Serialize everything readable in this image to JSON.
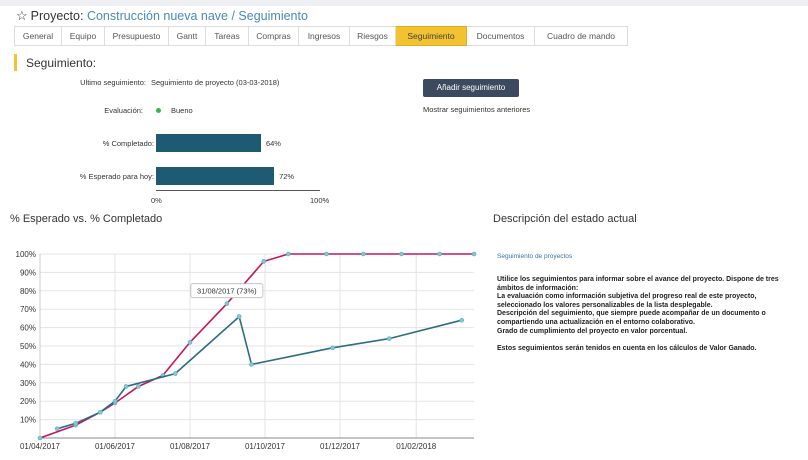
{
  "header": {
    "star_icon": "star-outline-icon",
    "prefix": "Proyecto:",
    "project_path": "Construcción nueva nave / Seguimiento"
  },
  "tabs": [
    {
      "label": "General",
      "active": false
    },
    {
      "label": "Equipo",
      "active": false
    },
    {
      "label": "Presupuesto",
      "active": false
    },
    {
      "label": "Gantt",
      "active": false
    },
    {
      "label": "Tareas",
      "active": false
    },
    {
      "label": "Compras",
      "active": false
    },
    {
      "label": "Ingresos",
      "active": false
    },
    {
      "label": "Riesgos",
      "active": false
    },
    {
      "label": "Seguimiento",
      "active": true
    },
    {
      "label": "Documentos",
      "active": false
    },
    {
      "label": "Cuadro de mando",
      "active": false
    }
  ],
  "seguimiento": {
    "section_title": "Seguimiento:",
    "last_label": "Ultimo seguimiento:",
    "last_value": "Seguimiento de proyecto (03-03-2018)",
    "eval_label": "Evaluación:",
    "eval_value": "Bueno",
    "eval_color": "#3cb44b",
    "add_button": "Añadir seguimiento",
    "show_prev": "Mostrar seguimientos anteriores"
  },
  "progress": {
    "completed_label": "% Completado:",
    "completed_value": "64%",
    "completed_fraction": 0.64,
    "expected_label": "% Esperado para hoy:",
    "expected_value": "72%",
    "expected_fraction": 0.72,
    "axis_min": "0%",
    "axis_max": "100%",
    "bar_color": "#1f5a73"
  },
  "chart_section_title": "% Esperado vs. % Completado",
  "description": {
    "title": "Descripción del estado actual",
    "subtitle": "Seguimiento de proyectos",
    "lines": [
      "Utilice los seguimientos para informar sobre el avance del proyecto. Dispone de tres",
      "ámbitos de información:",
      "La evaluación como información subjetiva del progreso real de este proyecto,",
      "seleccionado los valores personalizables de la lista desplegable.",
      "Descripción del seguimiento, que siempre puede acompañar de un documento o",
      "compartiendo una actualización en el entorno colaborativo.",
      "Grado de cumplimiento del proyecto en valor porcentual."
    ],
    "closing": "Estos seguimientos serán tenidos en cuenta en los cálculos de Valor Ganado."
  },
  "chart_data": {
    "type": "line",
    "title": "% Esperado vs. % Completado",
    "xlabel": "",
    "ylabel": "",
    "x_tick_labels": [
      "01/04/2017",
      "01/06/2017",
      "01/08/2017",
      "01/10/2017",
      "01/12/2017",
      "01/02/2018"
    ],
    "y_tick_labels": [
      "10%",
      "20%",
      "30%",
      "40%",
      "50%",
      "60%",
      "70%",
      "80%",
      "90%",
      "100%"
    ],
    "ylim": [
      0,
      100
    ],
    "xlim": [
      "2017-04-01",
      "2018-03-20"
    ],
    "grid": true,
    "series": [
      {
        "color": "#c2185b",
        "points": [
          {
            "x": "2017-04-01",
            "y": 0
          },
          {
            "x": "2017-04-30",
            "y": 7
          },
          {
            "x": "2017-05-20",
            "y": 14
          },
          {
            "x": "2017-06-01",
            "y": 19
          },
          {
            "x": "2017-06-20",
            "y": 28
          },
          {
            "x": "2017-07-10",
            "y": 34
          },
          {
            "x": "2017-08-01",
            "y": 52
          },
          {
            "x": "2017-08-31",
            "y": 73
          },
          {
            "x": "2017-09-30",
            "y": 96
          },
          {
            "x": "2017-10-20",
            "y": 100
          },
          {
            "x": "2017-11-20",
            "y": 100
          },
          {
            "x": "2017-12-20",
            "y": 100
          },
          {
            "x": "2018-01-20",
            "y": 100
          },
          {
            "x": "2018-02-20",
            "y": 100
          },
          {
            "x": "2018-03-20",
            "y": 100
          }
        ]
      },
      {
        "color": "#2e6b85",
        "points": [
          {
            "x": "2017-04-15",
            "y": 5
          },
          {
            "x": "2017-04-30",
            "y": 8
          },
          {
            "x": "2017-05-20",
            "y": 14
          },
          {
            "x": "2017-06-01",
            "y": 20
          },
          {
            "x": "2017-06-10",
            "y": 28
          },
          {
            "x": "2017-07-20",
            "y": 35
          },
          {
            "x": "2017-09-10",
            "y": 66
          },
          {
            "x": "2017-09-20",
            "y": 40
          },
          {
            "x": "2017-11-25",
            "y": 49
          },
          {
            "x": "2018-01-10",
            "y": 54
          },
          {
            "x": "2018-03-10",
            "y": 64
          }
        ]
      }
    ],
    "tooltip": {
      "x": "2017-08-31",
      "y": 73,
      "text": "31/08/2017 (73%)"
    }
  }
}
